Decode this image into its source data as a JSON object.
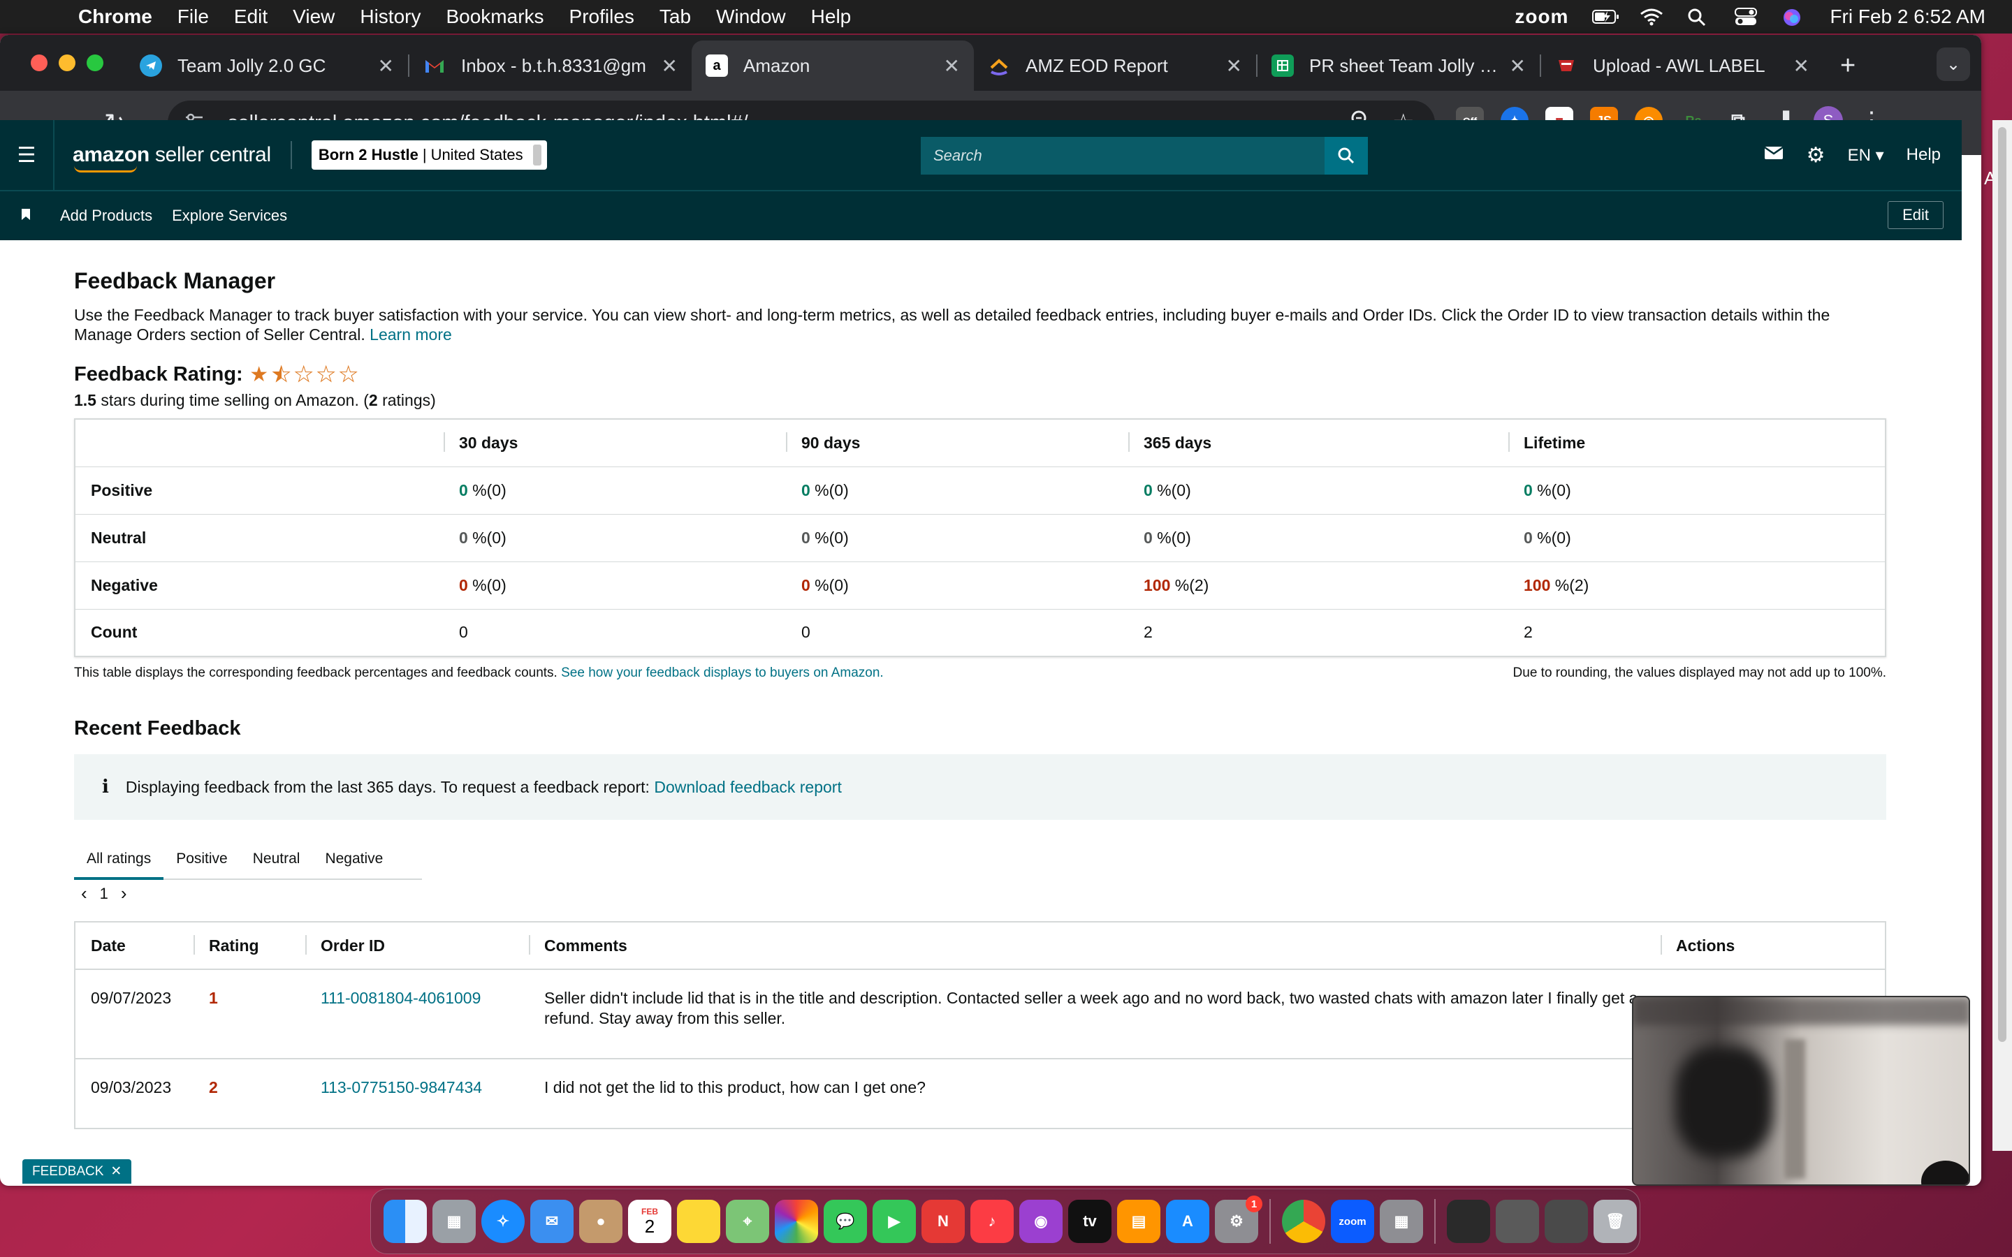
{
  "menubar": {
    "app_name": "Chrome",
    "items": [
      "File",
      "Edit",
      "View",
      "History",
      "Bookmarks",
      "Profiles",
      "Tab",
      "Window",
      "Help"
    ],
    "zoom_label": "zoom",
    "clock": "Fri Feb 2  6:52 AM"
  },
  "browser": {
    "tabs": [
      {
        "title": "Team Jolly 2.0 GC",
        "favicon_color": "#2aa3df",
        "favicon_icon": "telegram-icon"
      },
      {
        "title": "Inbox - b.t.h.8331@gm",
        "favicon_color": "#ea4335",
        "favicon_icon": "gmail-icon"
      },
      {
        "title": "Amazon",
        "favicon_color": "#000000",
        "favicon_icon": "amazon-icon"
      },
      {
        "title": "AMZ EOD Report",
        "favicon_color": "#f0a030",
        "favicon_icon": "clickup-icon"
      },
      {
        "title": "PR sheet Team Jolly - S",
        "favicon_color": "#0f9d58",
        "favicon_icon": "sheets-icon"
      },
      {
        "title": "Upload - AWL LABEL",
        "favicon_color": "#c62828",
        "favicon_icon": "awl-icon"
      }
    ],
    "url": "sellercentral.amazon.com/feedback-manager/index.html#/",
    "ext_off_label": "Off"
  },
  "header": {
    "logo_amazon": "amazon",
    "logo_rest": " seller central",
    "store": "Born 2 Hustle",
    "marketplace": "United States",
    "search_placeholder": "Search",
    "lang": "EN",
    "help": "Help"
  },
  "subnav": {
    "items": [
      "Add Products",
      "Explore Services"
    ],
    "edit": "Edit"
  },
  "feedback": {
    "title": "Feedback Manager",
    "intro": "Use the Feedback Manager to track buyer satisfaction with your service. You can view short- and long-term metrics, as well as detailed feedback entries, including buyer e-mails and Order IDs. Click the Order ID to view transaction details within the Manage Orders section of Seller Central.",
    "learn_more": "Learn more",
    "rating_label": "Feedback Rating:",
    "rating_stars": 1.5,
    "stars_value": "1.5",
    "stars_text": " stars during time selling on Amazon. (",
    "ratings_count": "2",
    "ratings_text": " ratings)",
    "columns": [
      "30 days",
      "90 days",
      "365 days",
      "Lifetime"
    ],
    "rows": [
      {
        "label": "Positive",
        "cells": [
          [
            "0",
            " %(0)"
          ],
          [
            "0",
            " %(0)"
          ],
          [
            "0",
            " %(0)"
          ],
          [
            "0",
            " %(0)"
          ]
        ]
      },
      {
        "label": "Neutral",
        "cells": [
          [
            "0",
            " %(0)"
          ],
          [
            "0",
            " %(0)"
          ],
          [
            "0",
            " %(0)"
          ],
          [
            "0",
            " %(0)"
          ]
        ]
      },
      {
        "label": "Negative",
        "cells": [
          [
            "0",
            " %(0)"
          ],
          [
            "0",
            " %(0)"
          ],
          [
            "100",
            " %(2)"
          ],
          [
            "100",
            " %(2)"
          ]
        ]
      },
      {
        "label": "Count",
        "cells": [
          [
            "0",
            ""
          ],
          [
            "0",
            ""
          ],
          [
            "2",
            ""
          ],
          [
            "2",
            ""
          ]
        ]
      }
    ],
    "note_left": "This table displays the corresponding feedback percentages and feedback counts.",
    "note_link": "See how your feedback displays to buyers on Amazon.",
    "note_right": "Due to rounding, the values displayed may not add up to 100%."
  },
  "recent": {
    "title": "Recent Feedback",
    "info_icon": "i",
    "info_text": "Displaying feedback from the last 365 days. To request a feedback report:",
    "info_link": "Download feedback report",
    "tabs": [
      "All ratings",
      "Positive",
      "Neutral",
      "Negative"
    ],
    "page": "1",
    "columns": [
      "Date",
      "Rating",
      "Order ID",
      "Comments",
      "Actions"
    ],
    "rows": [
      {
        "date": "09/07/2023",
        "rating": "1",
        "order_id": "111-0081804-4061009",
        "comment": "Seller didn't include lid that is in the title and description. Contacted seller a week ago and no word back, two wasted chats with amazon later I finally get a refund. Stay away from this seller."
      },
      {
        "date": "09/03/2023",
        "rating": "2",
        "order_id": "113-0775150-9847434",
        "comment": "I did not get the lid to this product, how can I get one?"
      }
    ]
  },
  "feedback_tag": "FEEDBACK",
  "partial_am": "AM",
  "dock": {
    "calendar_day": "2",
    "calendar_month": "FEB",
    "settings_badge": "1",
    "zoom_label": "zoom"
  }
}
